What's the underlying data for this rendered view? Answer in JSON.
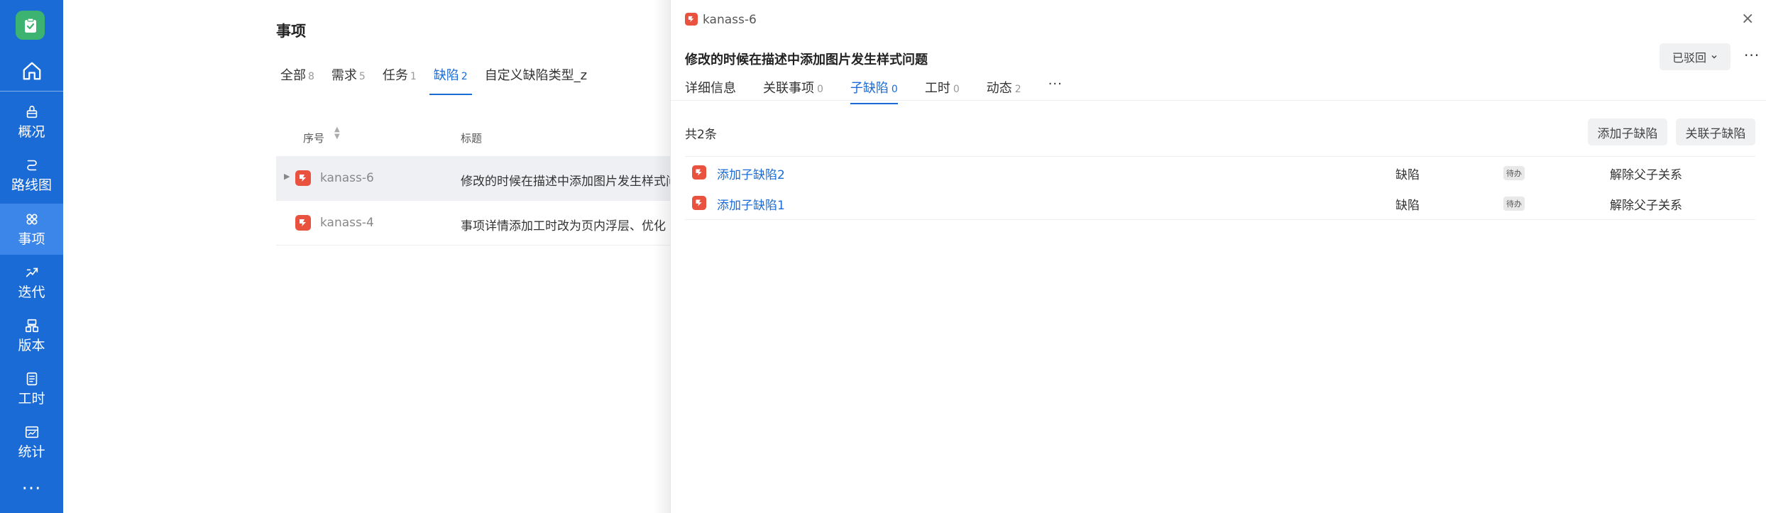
{
  "sidebar": {
    "items": [
      {
        "label": "概况",
        "icon": "overview-icon"
      },
      {
        "label": "路线图",
        "icon": "roadmap-icon"
      },
      {
        "label": "事项",
        "icon": "work-item-icon"
      },
      {
        "label": "迭代",
        "icon": "sprint-icon"
      },
      {
        "label": "版本",
        "icon": "version-icon"
      },
      {
        "label": "工时",
        "icon": "worklog-icon"
      },
      {
        "label": "统计",
        "icon": "statistics-icon"
      }
    ],
    "more": "···",
    "active_index": 2,
    "accent": "#1a6bd6",
    "logo_color": "#3cb371"
  },
  "main": {
    "title": "事项",
    "tabs": [
      {
        "label": "全部",
        "count": "8"
      },
      {
        "label": "需求",
        "count": "5"
      },
      {
        "label": "任务",
        "count": "1"
      },
      {
        "label": "缺陷",
        "count": "2"
      },
      {
        "label": "自定义缺陷类型_z",
        "count": ""
      }
    ],
    "active_tab": 3,
    "columns": {
      "index": "序号",
      "title": "标题"
    },
    "rows": [
      {
        "key": "kanass-6",
        "title": "修改的时候在描述中添加图片发生样式问题"
      },
      {
        "key": "kanass-4",
        "title": "事项详情添加工时改为页内浮层、优化"
      }
    ]
  },
  "drawer": {
    "key": "kanass-6",
    "close": "×",
    "title": "修改的时候在描述中添加图片发生样式问题",
    "status": "已驳回",
    "more": "···",
    "tabs": [
      {
        "label": "详细信息",
        "count": ""
      },
      {
        "label": "关联事项",
        "count": "0"
      },
      {
        "label": "子缺陷",
        "count": "0"
      },
      {
        "label": "工时",
        "count": "0"
      },
      {
        "label": "动态",
        "count": "2"
      }
    ],
    "tabs_more": "···",
    "active_tab": 2,
    "count_text": "共2条",
    "add_button": "添加子缺陷",
    "link_button": "关联子缺陷",
    "children": [
      {
        "name": "添加子缺陷2",
        "type": "缺陷",
        "status": "待办",
        "action": "解除父子关系"
      },
      {
        "name": "添加子缺陷1",
        "type": "缺陷",
        "status": "待办",
        "action": "解除父子关系"
      }
    ],
    "bug_icon_color": "#e8523f"
  }
}
